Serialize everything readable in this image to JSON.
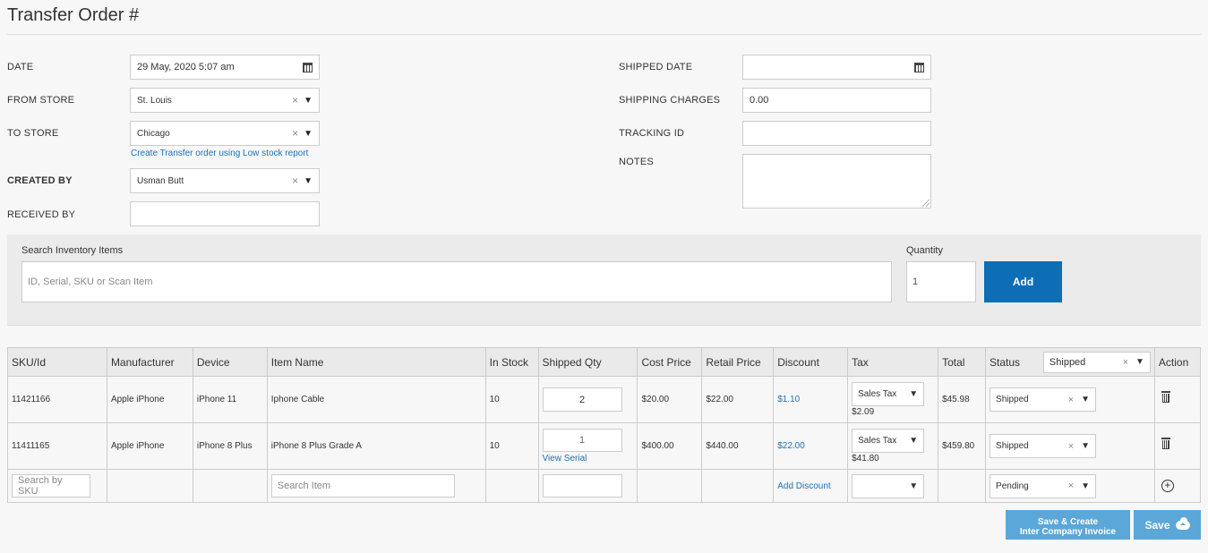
{
  "page": {
    "title": "Transfer Order #"
  },
  "form": {
    "date_label": "DATE",
    "date_value": "29 May, 2020  5:07 am",
    "from_store_label": "FROM STORE",
    "from_store_value": "St. Louis",
    "to_store_label": "TO STORE",
    "to_store_value": "Chicago",
    "low_stock_link": "Create Transfer order using Low stock report",
    "created_by_label": "CREATED BY",
    "created_by_value": "Usman Butt",
    "received_by_label": "RECEIVED BY",
    "received_by_value": "",
    "shipped_date_label": "SHIPPED DATE",
    "shipped_date_value": "",
    "shipping_charges_label": "SHIPPING CHARGES",
    "shipping_charges_value": "0.00",
    "tracking_id_label": "TRACKING ID",
    "tracking_id_value": "",
    "notes_label": "NOTES",
    "notes_value": ""
  },
  "search": {
    "label": "Search Inventory Items",
    "placeholder": "ID, Serial, SKU or Scan Item",
    "quantity_label": "Quantity",
    "quantity_value": "1",
    "add_label": "Add"
  },
  "table": {
    "headers": {
      "sku": "SKU/Id",
      "manufacturer": "Manufacturer",
      "device": "Device",
      "item_name": "Item Name",
      "in_stock": "In Stock",
      "shipped_qty": "Shipped Qty",
      "cost_price": "Cost Price",
      "retail_price": "Retail Price",
      "discount": "Discount",
      "tax": "Tax",
      "total": "Total",
      "status": "Status",
      "status_filter": "Shipped",
      "action": "Action"
    },
    "rows": [
      {
        "sku": "11421166",
        "manufacturer": "Apple iPhone",
        "device": "iPhone 11",
        "item_name": "Iphone Cable",
        "in_stock": "10",
        "shipped_qty": "2",
        "cost_price": "$20.00",
        "retail_price": "$22.00",
        "discount": "$1.10",
        "tax_type": "Sales Tax",
        "tax_amount": "$2.09",
        "total": "$45.98",
        "status": "Shipped"
      },
      {
        "sku": "11411165",
        "manufacturer": "Apple iPhone",
        "device": "iPhone 8 Plus",
        "item_name": "iPhone 8 Plus Grade A",
        "in_stock": "10",
        "shipped_qty": "1",
        "view_serial": "View Serial",
        "cost_price": "$400.00",
        "retail_price": "$440.00",
        "discount": "$22.00",
        "tax_type": "Sales Tax",
        "tax_amount": "$41.80",
        "total": "$459.80",
        "status": "Shipped"
      }
    ],
    "new_row": {
      "sku_placeholder": "Search by SKU",
      "item_placeholder": "Search Item",
      "add_discount": "Add Discount",
      "status": "Pending"
    }
  },
  "actions": {
    "save_invoice_line1": "Save & Create",
    "save_invoice_line2": "Inter Company Invoice",
    "save_label": "Save"
  },
  "colors": {
    "primary": "#0d6eb5",
    "secondary_button": "#5aa7d8",
    "link": "#1a73b8"
  }
}
